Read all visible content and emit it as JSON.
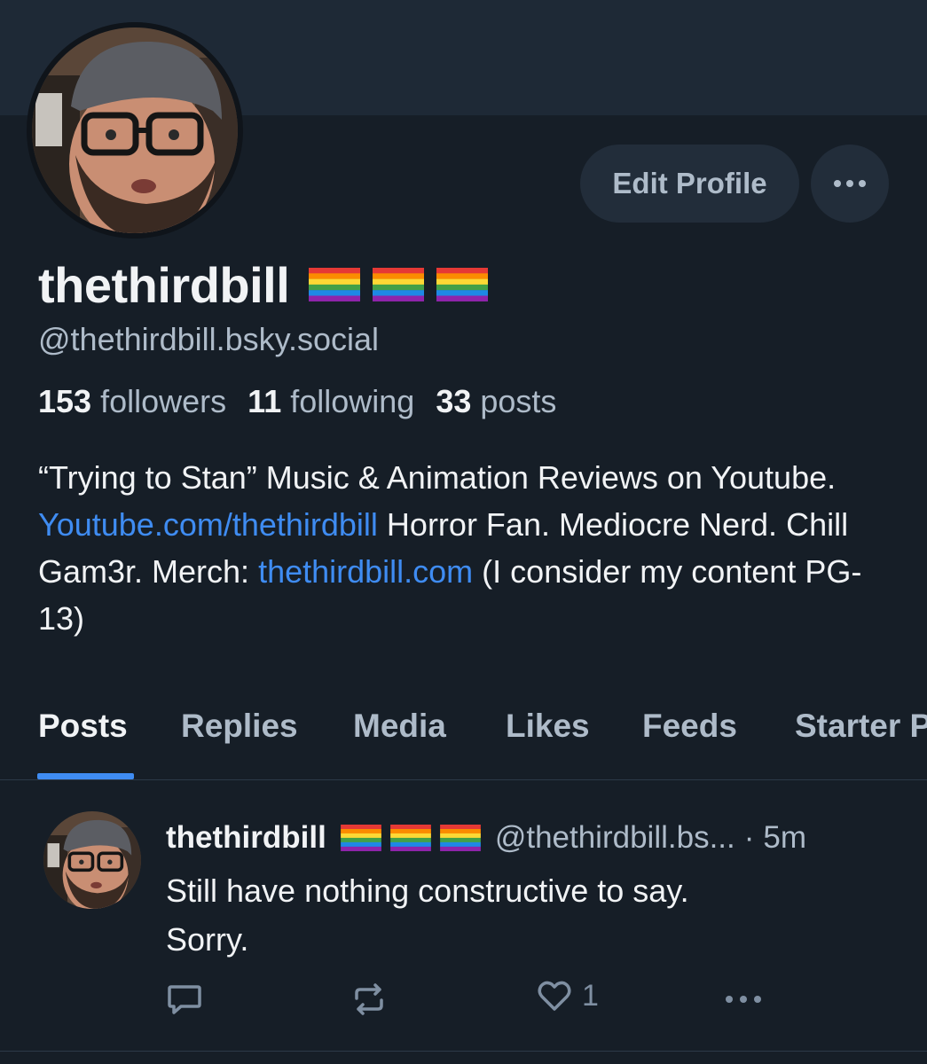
{
  "profile": {
    "display_name": "thethirdbill",
    "flag_emoji": [
      "rainbow-flag",
      "rainbow-flag",
      "rainbow-flag"
    ],
    "handle": "@thethirdbill.bsky.social",
    "edit_label": "Edit Profile",
    "stats": {
      "followers_count": "153",
      "followers_label": "followers",
      "following_count": "11",
      "following_label": "following",
      "posts_count": "33",
      "posts_label": "posts"
    },
    "bio": {
      "part1": "“Trying to Stan” Music & Animation Reviews on Youtube. ",
      "link1": "Youtube.com/thethirdbill",
      "part2": " Horror Fan. Mediocre Nerd. Chill Gam3r. Merch: ",
      "link2": "thethirdbill.com",
      "part3": " (I consider my content PG-13)"
    }
  },
  "tabs": [
    {
      "label": "Posts",
      "active": true
    },
    {
      "label": "Replies",
      "active": false
    },
    {
      "label": "Media",
      "active": false
    },
    {
      "label": "Likes",
      "active": false
    },
    {
      "label": "Feeds",
      "active": false
    },
    {
      "label": "Starter Packs",
      "active": false
    }
  ],
  "post": {
    "author": "thethirdbill",
    "handle": "@thethirdbill.bs...",
    "separator": "·",
    "time": "5m",
    "text_line1": "Still have nothing constructive to say.",
    "text_line2": "Sorry.",
    "like_count": "1",
    "icons": [
      "reply-icon",
      "repost-icon",
      "heart-icon",
      "more-icon"
    ]
  },
  "colors": {
    "background": "#161e27",
    "banner": "#1e2936",
    "accent": "#3f8cf2",
    "muted_text": "#aebbc9",
    "button_bg": "#222d3a"
  }
}
